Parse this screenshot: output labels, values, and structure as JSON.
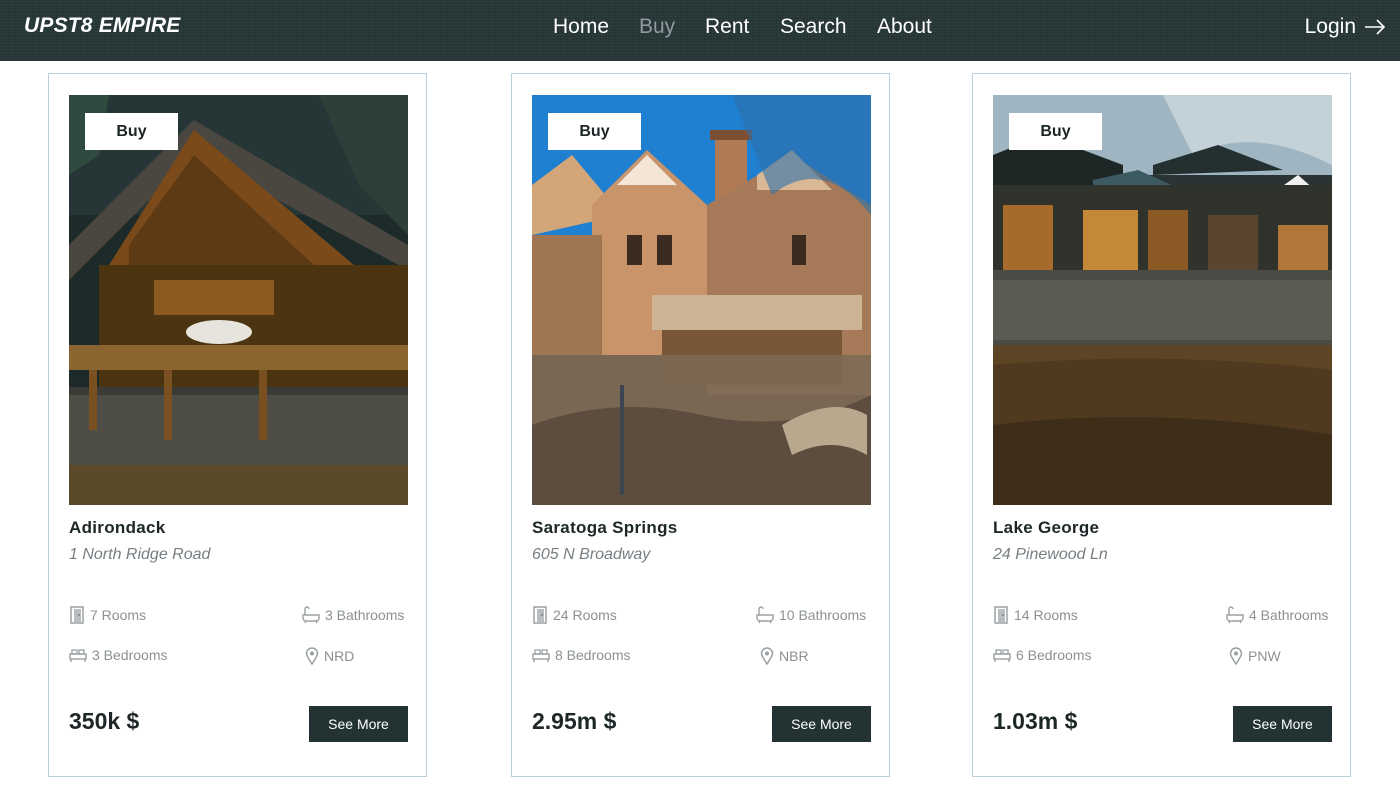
{
  "nav": {
    "brand": "UPST8 EMPIRE",
    "links": [
      "Home",
      "Buy",
      "Rent",
      "Search",
      "About"
    ],
    "active": "Buy",
    "login": "Login"
  },
  "listings": [
    {
      "badge": "Buy",
      "city": "Adirondack",
      "address": "1 North Ridge Road",
      "rooms": "7 Rooms",
      "bathrooms": "3 Bathrooms",
      "bedrooms": "3 Bedrooms",
      "region": "NRD",
      "price": "350k $",
      "button": "See More"
    },
    {
      "badge": "Buy",
      "city": "Saratoga Springs",
      "address": "605 N Broadway",
      "rooms": "24 Rooms",
      "bathrooms": "10 Bathrooms",
      "bedrooms": "8 Bedrooms",
      "region": "NBR",
      "price": "2.95m $",
      "button": "See More"
    },
    {
      "badge": "Buy",
      "city": "Lake George",
      "address": "24 Pinewood Ln",
      "rooms": "14 Rooms",
      "bathrooms": "4 Bathrooms",
      "bedrooms": "6 Bedrooms",
      "region": "PNW",
      "price": "1.03m $",
      "button": "See More"
    }
  ],
  "icons": {
    "rooms": "door-icon",
    "bathrooms": "bathtub-icon",
    "bedrooms": "bed-icon",
    "region": "map-pin-icon",
    "login": "arrow-right-icon"
  },
  "colors": {
    "navbar": "#253434",
    "active_link": "#8f9ba1",
    "button": "#233232",
    "card_border": "#bcd0dc",
    "muted_text": "#8b9194"
  }
}
